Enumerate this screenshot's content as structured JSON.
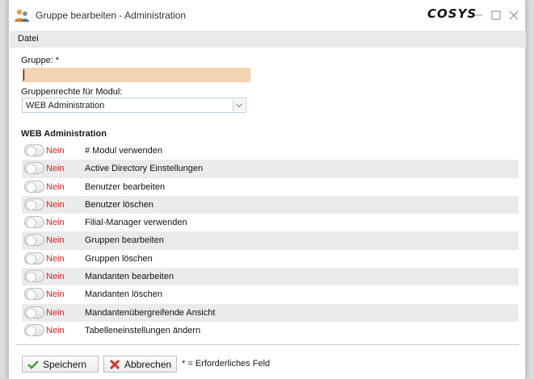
{
  "window": {
    "title": "Gruppe bearbeiten - Administration",
    "brand": "COSYS"
  },
  "menu": {
    "items": [
      "Datei"
    ]
  },
  "form": {
    "group_label": "Gruppe: *",
    "group_value": "",
    "rights_label": "Gruppenrechte für Modul:",
    "module_selected": "WEB Administration"
  },
  "section": {
    "title": "WEB Administration"
  },
  "permissions": [
    {
      "state": "Nein",
      "label": "# Modul verwenden"
    },
    {
      "state": "Nein",
      "label": "Active Directory Einstellungen"
    },
    {
      "state": "Nein",
      "label": "Benutzer bearbeiten"
    },
    {
      "state": "Nein",
      "label": "Benutzer löschen"
    },
    {
      "state": "Nein",
      "label": "Filial-Manager verwenden"
    },
    {
      "state": "Nein",
      "label": "Gruppen bearbeiten"
    },
    {
      "state": "Nein",
      "label": "Gruppen löschen"
    },
    {
      "state": "Nein",
      "label": "Mandanten bearbeiten"
    },
    {
      "state": "Nein",
      "label": "Mandanten löschen"
    },
    {
      "state": "Nein",
      "label": "Mandantenübergreifende Ansicht"
    },
    {
      "state": "Nein",
      "label": "Tabelleneinstellungen ändern"
    }
  ],
  "footer": {
    "save_label": "Speichern",
    "cancel_label": "Abbrechen",
    "required_note": "* = Erforderliches Feld"
  },
  "colors": {
    "required_field_bg": "#f2d4b2",
    "no_state": "#e02020",
    "stripe": "#ebebeb"
  }
}
